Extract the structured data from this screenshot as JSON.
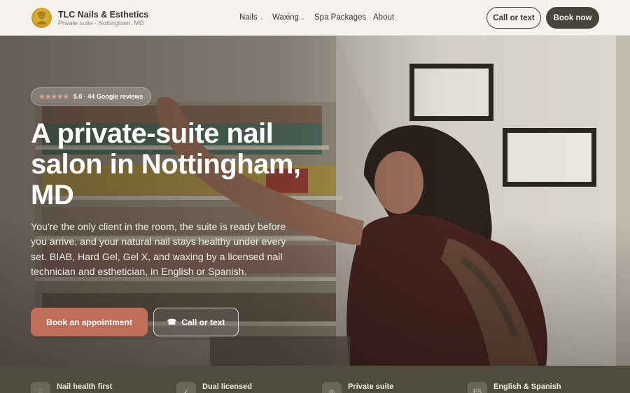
{
  "brand": {
    "name": "TLC Nails & Esthetics",
    "subtitle": "Private suite · Nottingham, MD"
  },
  "nav": {
    "items": [
      {
        "label": "Nails",
        "has_dropdown": true
      },
      {
        "label": "Waxing",
        "has_dropdown": true
      },
      {
        "label": "Spa Packages",
        "has_dropdown": false
      },
      {
        "label": "About",
        "has_dropdown": false
      }
    ],
    "caret": "⌄"
  },
  "header_actions": {
    "call_label": "Call or text",
    "book_label": "Book now"
  },
  "hero": {
    "rating_stars": "★★★★★",
    "rating_text": "5.0 · 44 Google reviews",
    "headline": "A private-suite nail salon in Nottingham, MD",
    "lede": "You're the only client in the room, the suite is ready before you arrive, and your natural nail stays healthy under every set. BIAB, Hard Gel, Gel X, and waxing by a licensed nail technician and esthetician, in English or Spanish.",
    "cta_book": "Book an appointment",
    "cta_call": "Call or text",
    "cta_call_icon": "phone-icon"
  },
  "features": [
    {
      "label": "Nail health first",
      "icon": "heart-icon",
      "glyph": "♡"
    },
    {
      "label": "Dual licensed",
      "icon": "check-icon",
      "glyph": "✓"
    },
    {
      "label": "Private suite",
      "icon": "lock-icon",
      "glyph": "◎"
    },
    {
      "label": "English & Spanish",
      "icon": "language-icon",
      "glyph": "ES"
    }
  ],
  "colors": {
    "accent": "#c06d59",
    "dark": "#47443a",
    "strip": "#4f4c3f",
    "background": "#f6f3ee"
  }
}
